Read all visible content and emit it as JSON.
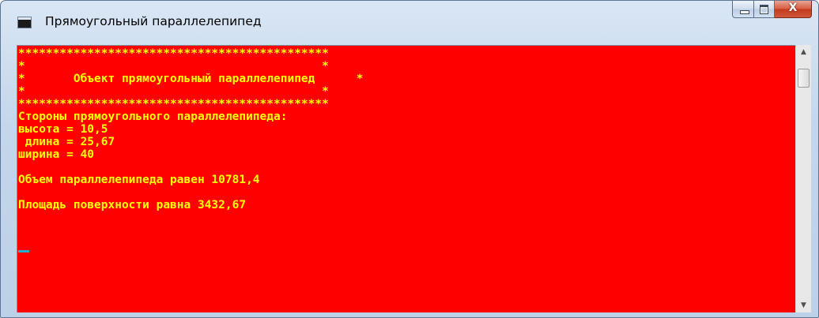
{
  "window": {
    "title": "Прямоугольный параллелепипед",
    "icon": "console-app-icon",
    "controls": {
      "minimize": "minimize-icon",
      "maximize": "maximize-icon",
      "close_glyph": "X"
    }
  },
  "console": {
    "background_color": "#ff0000",
    "text_color": "#ffff00",
    "cursor_color": "#21b0c8",
    "lines": [
      "*********************************************",
      "*                                           *",
      "*       Объект прямоугольный параллелепипед      *",
      "*                                           *",
      "*********************************************",
      "Стороны прямоугольного параллелепипеда:",
      "высота = 10,5",
      " длина = 25,67",
      "ширина = 40",
      "",
      "Объем параллелепипеда равен 10781,4",
      "",
      "Площадь поверхности равна 3432,67"
    ]
  },
  "scrollbar": {
    "up_icon": "▲",
    "down_icon": "▼"
  }
}
